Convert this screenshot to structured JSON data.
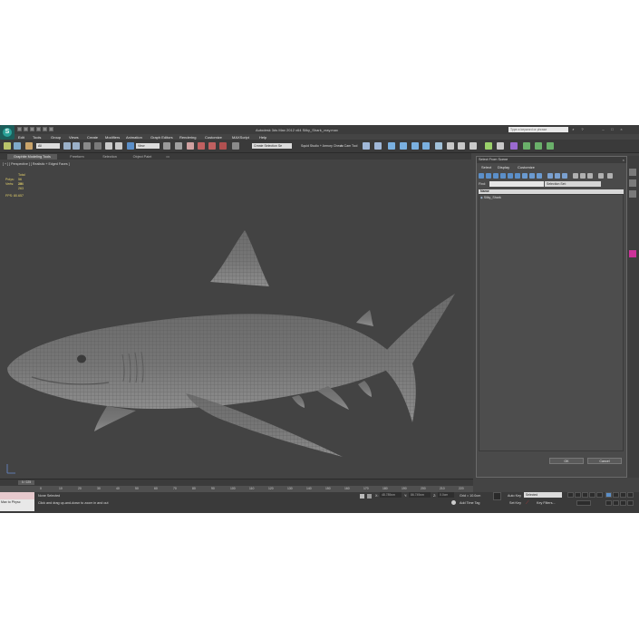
{
  "app": {
    "title": "Autodesk 3ds Max  2012 x64      Silky_Shark_vray.max",
    "search_placeholder": "Type a keyword or phrase",
    "maxscript_label": "Max to Physc"
  },
  "menu": [
    "Edit",
    "Tools",
    "Group",
    "Views",
    "Create",
    "Modifiers",
    "Animation",
    "Graph Editors",
    "Rendering",
    "Customize",
    "MAXScript",
    "Help"
  ],
  "toolbar": {
    "filter_value": "All",
    "view_value": "View",
    "selection_set": "Create Selection Se",
    "squid_text": "Squid Studio + Armory Check",
    "zero_text": "zo Cam Tool"
  },
  "ribbon": {
    "tabs": [
      "Graphite Modeling Tools",
      "Freeform",
      "Selection",
      "Object Paint"
    ]
  },
  "viewport": {
    "label": "[ + ] [ Perspective ] [ Realistic + Edged Faces ]",
    "stats": {
      "total_label": "Total",
      "polys_label": "Polys:",
      "polys_value": "56 196",
      "verts_label": "Verts:",
      "verts_value": "28 263",
      "fps_label": "FPS:",
      "fps_value": "80.657"
    }
  },
  "scene_panel": {
    "title": "Select From Scene",
    "menu": [
      "Select",
      "Display",
      "Customize"
    ],
    "find_label": "Find:",
    "selection_set_label": "Selection Set:",
    "column_header": "Name",
    "items": [
      "Silky_Shark"
    ],
    "ok_label": "OK",
    "cancel_label": "Cancel"
  },
  "timeline": {
    "slider": "0 / 225",
    "ticks": [
      "0",
      "10",
      "20",
      "30",
      "40",
      "50",
      "60",
      "70",
      "80",
      "90",
      "100",
      "110",
      "120",
      "130",
      "140",
      "150",
      "160",
      "170",
      "180",
      "190",
      "200",
      "210",
      "220"
    ]
  },
  "status": {
    "selection": "None Selected",
    "prompt": "Click and drag up-and-down to zoom in and out",
    "x_label": "X:",
    "x_placeholder": "48.789cm",
    "y_label": "Y:",
    "y_placeholder": "86.749cm",
    "z_label": "Z:",
    "z_placeholder": "0.0cm",
    "grid": "Grid = 10.0cm",
    "add_time_tag": "Add Time Tag",
    "auto_key": "Auto Key",
    "auto_key_value": "Selected",
    "set_key": "Set Key",
    "key_filters": "Key Filters..."
  },
  "colors": {
    "app_bg": "#444444",
    "viewport_bg": "#434343",
    "stats_text": "#e6d36a",
    "accent_blue": "#5b8fc9",
    "logo_teal": "#2aa198",
    "autokey_red": "#c0393b"
  }
}
